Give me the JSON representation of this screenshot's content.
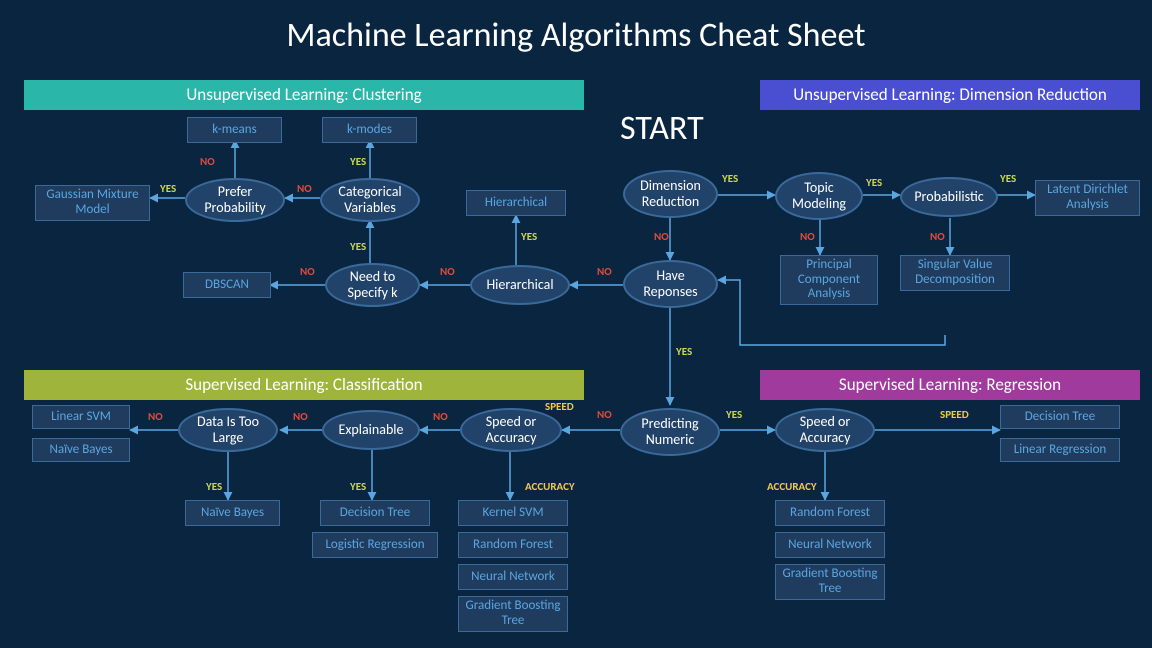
{
  "title": "Machine Learning Algorithms Cheat Sheet",
  "start": "START",
  "labels": {
    "yes": "YES",
    "no": "NO",
    "speed": "SPEED",
    "accuracy": "ACCURACY"
  },
  "sections": {
    "clustering": "Unsupervised Learning: Clustering",
    "dimred": "Unsupervised Learning: Dimension Reduction",
    "classification": "Supervised Learning: Classification",
    "regression": "Supervised Learning: Regression"
  },
  "decisions": {
    "dim_reduction": "Dimension Reduction",
    "have_responses": "Have Reponses",
    "predicting_numeric": "Predicting Numeric",
    "topic_modeling": "Topic Modeling",
    "probabilistic": "Probabilistic",
    "prefer_probability": "Prefer Probability",
    "categorical_variables": "Categorical Variables",
    "need_specify_k": "Need to Specify k",
    "hierarchical": "Hierarchical",
    "data_too_large": "Data Is Too Large",
    "explainable": "Explainable",
    "speed_or_accuracy_c": "Speed or Accuracy",
    "speed_or_accuracy_r": "Speed or Accuracy"
  },
  "algorithms": {
    "kmeans": "k-means",
    "kmodes": "k-modes",
    "gaussian_mixture": "Gaussian Mixture Model",
    "hierarchical_box": "Hierarchical",
    "dbscan": "DBSCAN",
    "latent_dirichlet": "Latent Dirichlet Analysis",
    "pca": "Principal Component Analysis",
    "svd": "Singular Value Decomposition",
    "linear_svm": "Linear SVM",
    "naive_bayes": "Naïve Bayes",
    "naive_bayes2": "Naïve Bayes",
    "decision_tree_c": "Decision Tree",
    "logistic_regression": "Logistic Regression",
    "kernel_svm": "Kernel SVM",
    "random_forest_c": "Random Forest",
    "neural_network_c": "Neural Network",
    "gradient_boosting_c": "Gradient Boosting Tree",
    "decision_tree_r": "Decision Tree",
    "linear_regression": "Linear Regression",
    "random_forest_r": "Random Forest",
    "neural_network_r": "Neural Network",
    "gradient_boosting_r": "Gradient Boosting Tree"
  }
}
